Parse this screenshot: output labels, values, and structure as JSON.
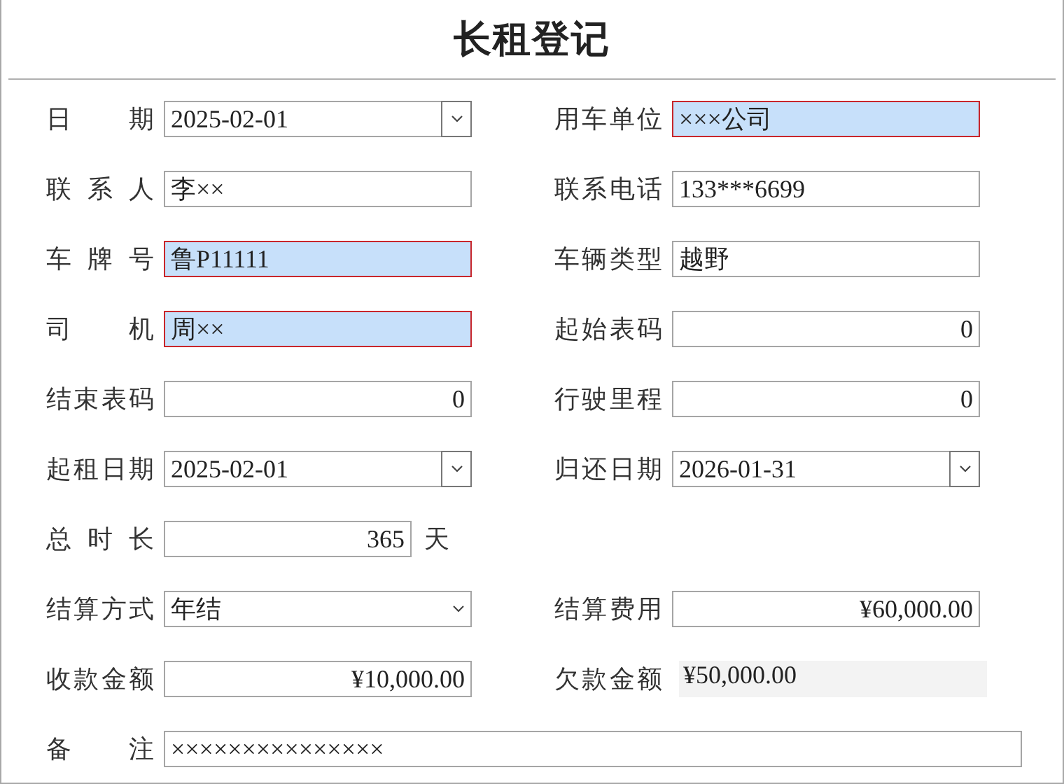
{
  "title": "长租登记",
  "rows": [
    [
      {
        "label": "日期",
        "kind": "date",
        "value": "2025-02-01",
        "highlighted": false
      },
      {
        "label": "用车单位",
        "kind": "text",
        "value": "×××公司",
        "highlighted": true
      }
    ],
    [
      {
        "label": "联系人",
        "kind": "text",
        "value": "李××",
        "highlighted": false
      },
      {
        "label": "联系电话",
        "kind": "text",
        "value": "133***6699",
        "highlighted": false
      }
    ],
    [
      {
        "label": "车牌号",
        "kind": "text",
        "value": "鲁P11111",
        "highlighted": true
      },
      {
        "label": "车辆类型",
        "kind": "text",
        "value": "越野",
        "highlighted": false
      }
    ],
    [
      {
        "label": "司机",
        "kind": "text",
        "value": "周××",
        "highlighted": true
      },
      {
        "label": "起始表码",
        "kind": "number",
        "value": "0",
        "highlighted": false
      }
    ],
    [
      {
        "label": "结束表码",
        "kind": "number",
        "value": "0",
        "highlighted": false
      },
      {
        "label": "行驶里程",
        "kind": "number",
        "value": "0",
        "highlighted": false
      }
    ],
    [
      {
        "label": "起租日期",
        "kind": "date",
        "value": "2025-02-01",
        "highlighted": false
      },
      {
        "label": "归还日期",
        "kind": "date",
        "value": "2026-01-31",
        "highlighted": false
      }
    ],
    [
      {
        "label": "总时长",
        "kind": "number",
        "value": "365",
        "unit": "天",
        "highlighted": false
      }
    ],
    [
      {
        "label": "结算方式",
        "kind": "select",
        "value": "年结",
        "highlighted": false
      },
      {
        "label": "结算费用",
        "kind": "number",
        "value": "¥60,000.00",
        "highlighted": false
      }
    ],
    [
      {
        "label": "收款金额",
        "kind": "number",
        "value": "¥10,000.00",
        "highlighted": false
      },
      {
        "label": "欠款金额",
        "kind": "display",
        "value": "¥50,000.00"
      }
    ],
    [
      {
        "label": "备注",
        "kind": "text",
        "value": "×××××××××××××××",
        "wide": true,
        "highlighted": false
      }
    ]
  ]
}
